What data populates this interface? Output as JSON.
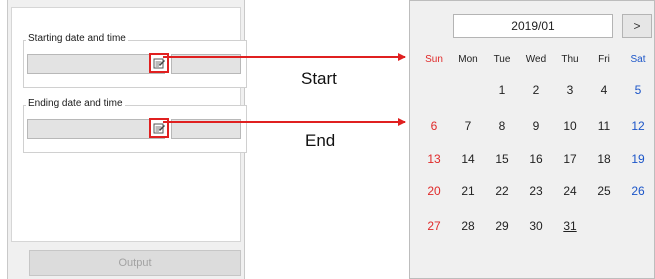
{
  "settings_panel": {
    "start_group_title": "Starting date and time",
    "end_group_title": "Ending date and time",
    "output_button_label": "Output"
  },
  "annotations": {
    "start_label": "Start",
    "end_label": "End",
    "highlight_color": "#e02020"
  },
  "calendar": {
    "month_label": "2019/01",
    "next_button_label": ">",
    "weekdays": [
      "Sun",
      "Mon",
      "Tue",
      "Wed",
      "Thu",
      "Fri",
      "Sat"
    ],
    "weeks": [
      [
        "",
        "",
        "1",
        "2",
        "3",
        "4",
        "5"
      ],
      [
        "6",
        "7",
        "8",
        "9",
        "10",
        "11",
        "12"
      ],
      [
        "13",
        "14",
        "15",
        "16",
        "17",
        "18",
        "19"
      ],
      [
        "20",
        "21",
        "22",
        "23",
        "24",
        "25",
        "26"
      ],
      [
        "27",
        "28",
        "29",
        "30",
        "31",
        "",
        ""
      ]
    ],
    "underlined_day": "31",
    "sunday_color": "#e02a2a",
    "saturday_color": "#1b55c8"
  }
}
